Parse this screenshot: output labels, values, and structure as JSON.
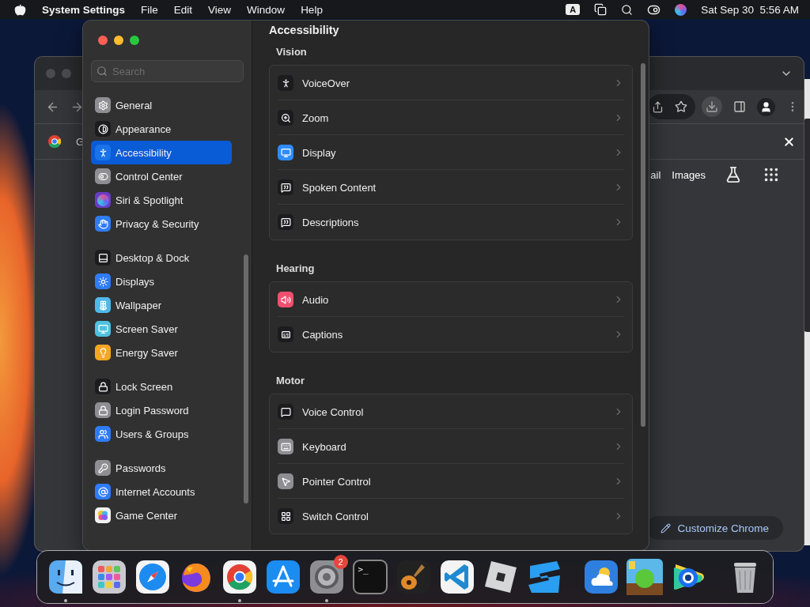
{
  "menu_bar": {
    "app_name": "System Settings",
    "menus": [
      "File",
      "Edit",
      "View",
      "Window",
      "Help"
    ],
    "input_source": "A",
    "clock": "Sat Sep 30  5:56 AM"
  },
  "browser_window": {
    "tab_title": "G",
    "nav_links": [
      "ail",
      "Images"
    ],
    "customize_button": "Customize Chrome"
  },
  "settings_window": {
    "search": {
      "placeholder": "Search"
    },
    "sidebar": {
      "groups": [
        {
          "items": [
            {
              "label": "General",
              "kind": "general",
              "color": "#8e8e93",
              "selected": false
            },
            {
              "label": "Appearance",
              "kind": "appearance",
              "color": "#1c1c1e",
              "selected": false
            },
            {
              "label": "Accessibility",
              "kind": "accessibility",
              "color": "#1a73e8",
              "selected": true
            },
            {
              "label": "Control Center",
              "kind": "control_center",
              "color": "#8e8e93",
              "selected": false
            },
            {
              "label": "Siri & Spotlight",
              "kind": "siri",
              "color": "#6a3cc4",
              "selected": false
            },
            {
              "label": "Privacy & Security",
              "kind": "privacy",
              "color": "#2f7cf6",
              "selected": false
            }
          ]
        },
        {
          "items": [
            {
              "label": "Desktop & Dock",
              "kind": "desktop_dock",
              "color": "#1c1c1e",
              "selected": false
            },
            {
              "label": "Displays",
              "kind": "displays",
              "color": "#2f7cf6",
              "selected": false
            },
            {
              "label": "Wallpaper",
              "kind": "wallpaper",
              "color": "#4fb8e8",
              "selected": false
            },
            {
              "label": "Screen Saver",
              "kind": "screen_saver",
              "color": "#4cc3e0",
              "selected": false
            },
            {
              "label": "Energy Saver",
              "kind": "energy",
              "color": "#f5a623",
              "selected": false
            }
          ]
        },
        {
          "items": [
            {
              "label": "Lock Screen",
              "kind": "lock_screen",
              "color": "#1c1c1e",
              "selected": false
            },
            {
              "label": "Login Password",
              "kind": "login_password",
              "color": "#8e8e93",
              "selected": false
            },
            {
              "label": "Users & Groups",
              "kind": "users",
              "color": "#2f7cf6",
              "selected": false
            }
          ]
        },
        {
          "items": [
            {
              "label": "Passwords",
              "kind": "passwords",
              "color": "#8e8e93",
              "selected": false
            },
            {
              "label": "Internet Accounts",
              "kind": "internet",
              "color": "#2f7cf6",
              "selected": false
            },
            {
              "label": "Game Center",
              "kind": "game_center",
              "color": "#f2f2f2",
              "selected": false
            }
          ]
        }
      ]
    },
    "content": {
      "title": "Accessibility",
      "sections": [
        {
          "heading": "Vision",
          "rows": [
            {
              "label": "VoiceOver",
              "kind": "voiceover",
              "color": "#1c1c1e"
            },
            {
              "label": "Zoom",
              "kind": "zoom",
              "color": "#1c1c1e"
            },
            {
              "label": "Display",
              "kind": "display",
              "color": "#2f8cf6"
            },
            {
              "label": "Spoken Content",
              "kind": "spoken",
              "color": "#1c1c1e"
            },
            {
              "label": "Descriptions",
              "kind": "descriptions",
              "color": "#1c1c1e"
            }
          ]
        },
        {
          "heading": "Hearing",
          "rows": [
            {
              "label": "Audio",
              "kind": "audio",
              "color": "#f0506e"
            },
            {
              "label": "Captions",
              "kind": "captions",
              "color": "#1c1c1e"
            }
          ]
        },
        {
          "heading": "Motor",
          "rows": [
            {
              "label": "Voice Control",
              "kind": "voice_control",
              "color": "#1c1c1e"
            },
            {
              "label": "Keyboard",
              "kind": "keyboard",
              "color": "#8e8e93"
            },
            {
              "label": "Pointer Control",
              "kind": "pointer",
              "color": "#8e8e93"
            },
            {
              "label": "Switch Control",
              "kind": "switch",
              "color": "#1c1c1e"
            }
          ]
        }
      ]
    }
  },
  "dock": {
    "groups": [
      {
        "items": [
          {
            "kind": "finder",
            "running": true
          },
          {
            "kind": "launchpad",
            "running": false
          },
          {
            "kind": "safari",
            "running": false
          },
          {
            "kind": "firefox",
            "running": false
          },
          {
            "kind": "chrome",
            "running": true
          },
          {
            "kind": "appstore",
            "running": false
          },
          {
            "kind": "settings",
            "running": true,
            "badge": "2"
          },
          {
            "kind": "terminal",
            "running": false,
            "label": ">_"
          },
          {
            "kind": "garageband",
            "running": false
          },
          {
            "kind": "vscode",
            "running": false
          },
          {
            "kind": "roblox",
            "running": false
          },
          {
            "kind": "stripes",
            "running": false
          }
        ]
      },
      {
        "items": [
          {
            "kind": "weather",
            "running": false
          },
          {
            "kind": "game",
            "running": false
          },
          {
            "kind": "eye",
            "running": false
          }
        ]
      },
      {
        "items": [
          {
            "kind": "trash",
            "running": false
          }
        ]
      }
    ]
  }
}
